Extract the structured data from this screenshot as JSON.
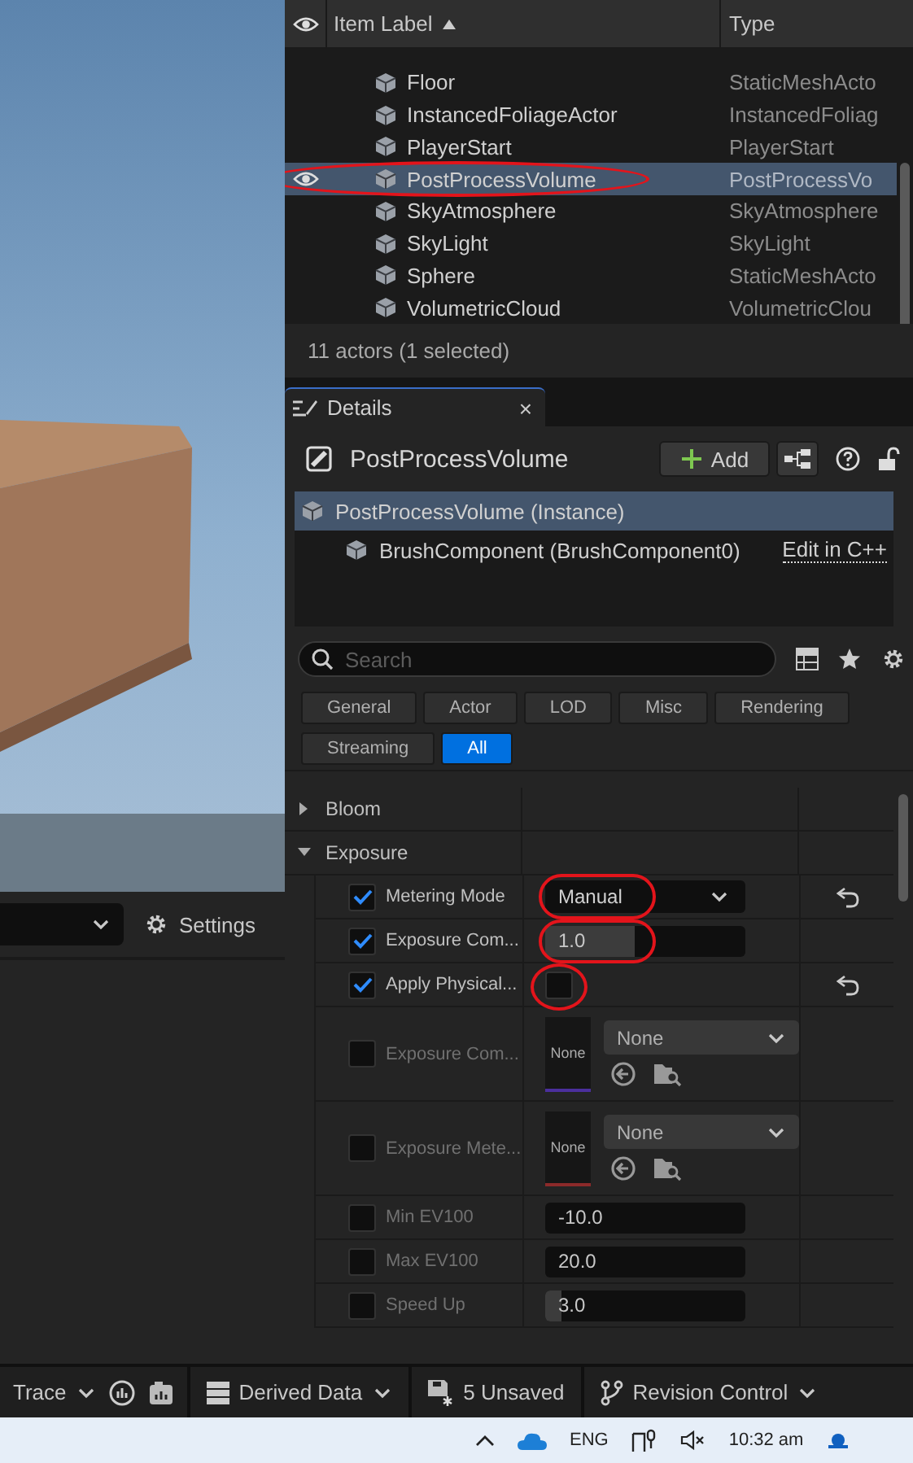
{
  "viewport": {
    "settings_button": "Settings"
  },
  "outliner": {
    "columns": [
      "Item Label",
      "Type"
    ],
    "rows": [
      {
        "label": "Floor",
        "type": "StaticMeshActo",
        "selected": false,
        "circled": false
      },
      {
        "label": "InstancedFoliageActor",
        "type": "InstancedFoliag",
        "selected": false,
        "circled": false
      },
      {
        "label": "PlayerStart",
        "type": "PlayerStart",
        "selected": false,
        "circled": false
      },
      {
        "label": "PostProcessVolume",
        "type": "PostProcessVo",
        "selected": true,
        "circled": true
      },
      {
        "label": "SkyAtmosphere",
        "type": "SkyAtmosphere",
        "selected": false,
        "circled": false
      },
      {
        "label": "SkyLight",
        "type": "SkyLight",
        "selected": false,
        "circled": false
      },
      {
        "label": "Sphere",
        "type": "StaticMeshActo",
        "selected": false,
        "circled": false
      },
      {
        "label": "VolumetricCloud",
        "type": "VolumetricClou",
        "selected": false,
        "circled": false
      }
    ],
    "footer": "11 actors (1 selected)"
  },
  "details": {
    "tab": {
      "label": "Details",
      "close": "×"
    },
    "actor": "PostProcessVolume",
    "add_button": "Add",
    "components": [
      {
        "label": "PostProcessVolume (Instance)",
        "selected": true,
        "children": [
          {
            "label": "BrushComponent (BrushComponent0)",
            "link": "Edit in C++",
            "selected": false
          }
        ]
      }
    ],
    "search": {
      "placeholder": "Search"
    },
    "filters": [
      {
        "label": "General",
        "selected": false
      },
      {
        "label": "Actor",
        "selected": false
      },
      {
        "label": "LOD",
        "selected": false
      },
      {
        "label": "Misc",
        "selected": false
      },
      {
        "label": "Rendering",
        "selected": false
      },
      {
        "label": "Streaming",
        "selected": false
      },
      {
        "label": "All",
        "selected": true
      }
    ],
    "sections": [
      {
        "label": "Bloom",
        "expanded": false
      },
      {
        "label": "Exposure",
        "expanded": true,
        "properties": [
          {
            "kind": "combo",
            "label": "Metering Mode",
            "checked": true,
            "value": "Manual",
            "resettable": true,
            "circled": true
          },
          {
            "kind": "number",
            "label": "Exposure Com...",
            "checked": true,
            "value": "1.0",
            "level": 0.45,
            "resettable": false,
            "circled": true
          },
          {
            "kind": "toggle",
            "label": "Apply Physical...",
            "checked": true,
            "value_checked": false,
            "resettable": true,
            "circled": true
          },
          {
            "kind": "asset",
            "label": "Exposure Com...",
            "checked": false,
            "thumbnail": "None",
            "value": "None",
            "color": "#4b2f9c",
            "resettable": false,
            "circled": false
          },
          {
            "kind": "asset",
            "label": "Exposure Mete...",
            "checked": false,
            "thumbnail": "None",
            "value": "None",
            "color": "#8c2a2a",
            "resettable": false,
            "circled": false
          },
          {
            "kind": "number",
            "label": "Min EV100",
            "checked": false,
            "value": "-10.0",
            "resettable": false,
            "circled": false
          },
          {
            "kind": "number",
            "label": "Max EV100",
            "checked": false,
            "value": "20.0",
            "resettable": false,
            "circled": false
          },
          {
            "kind": "number",
            "label": "Speed Up",
            "checked": false,
            "value": "3.0",
            "level": 0.08,
            "resettable": false,
            "circled": false
          }
        ]
      }
    ]
  },
  "status_bar": {
    "trace": "Trace",
    "derived_data": "Derived Data",
    "unsaved": "5 Unsaved",
    "revision_control": "Revision Control"
  },
  "taskbar": {
    "language": "ENG",
    "time": "10:32 am"
  }
}
